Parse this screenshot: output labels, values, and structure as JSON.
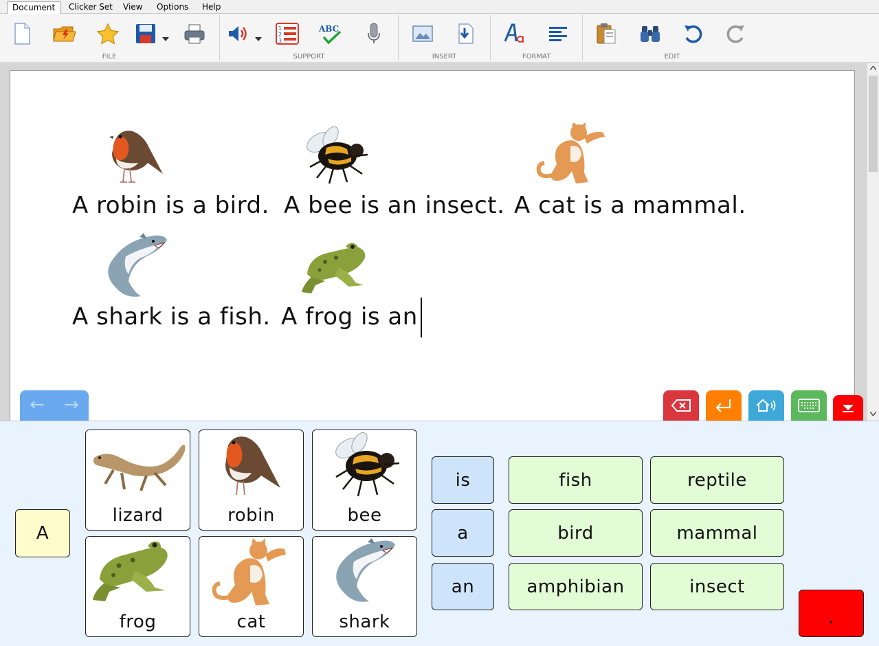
{
  "menu": {
    "items": [
      "Document",
      "Clicker Set",
      "View",
      "Options",
      "Help"
    ],
    "active": "Document"
  },
  "ribbon": {
    "groups": {
      "file": "FILE",
      "support": "SUPPORT",
      "insert": "INSERT",
      "format": "FORMAT",
      "edit": "EDIT"
    },
    "spell_icon_text": "ABC",
    "list_icon_numbers": [
      "1",
      "2",
      "3"
    ]
  },
  "document": {
    "sentences": [
      "A robin is a bird.",
      "A bee is an insect.",
      "A cat is a mammal.",
      "A shark is a fish.",
      "A frog is an"
    ]
  },
  "nav": {
    "back_icon": "←",
    "forward_icon": "→"
  },
  "tools": {
    "colors": {
      "backspace": "#d9363e",
      "enter": "#ff7f00",
      "speak": "#3ea8d8",
      "keyboard": "#5cb85c",
      "collapse": "#ff0000"
    }
  },
  "grid": {
    "starter": "A",
    "pictures": [
      "lizard",
      "robin",
      "bee",
      "frog",
      "cat",
      "shark"
    ],
    "verbs": [
      "is",
      "a",
      "an"
    ],
    "nouns": [
      "fish",
      "reptile",
      "bird",
      "mammal",
      "amphibian",
      "insect"
    ],
    "full_stop": "."
  }
}
